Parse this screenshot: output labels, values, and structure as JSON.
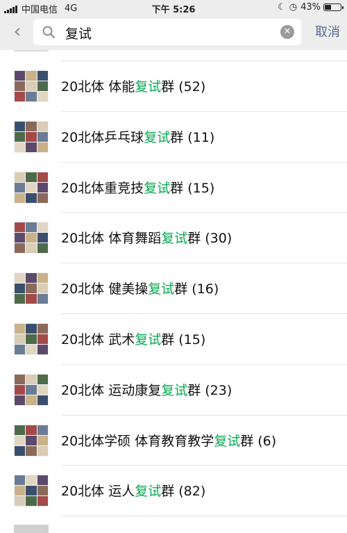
{
  "status_bar": {
    "carrier": "中国电信",
    "network": "4G",
    "time": "下午 5:26",
    "battery": "43%",
    "battery_level": 0.43
  },
  "search": {
    "query": "复试",
    "cancel_label": "取消"
  },
  "results": [
    {
      "prefix": "20北体 体能",
      "highlight": "复试",
      "suffix": "群 (52)"
    },
    {
      "prefix": "20北体乒乓球",
      "highlight": "复试",
      "suffix": "群 (11)"
    },
    {
      "prefix": "20北体重竞技",
      "highlight": "复试",
      "suffix": "群 (15)"
    },
    {
      "prefix": "20北体 体育舞蹈",
      "highlight": "复试",
      "suffix": "群 (30)"
    },
    {
      "prefix": "20北体 健美操",
      "highlight": "复试",
      "suffix": "群 (16)"
    },
    {
      "prefix": "20北体 武术",
      "highlight": "复试",
      "suffix": "群 (15)"
    },
    {
      "prefix": "20北体 运动康复",
      "highlight": "复试",
      "suffix": "群 (23)"
    },
    {
      "prefix": "20北体学硕 体育教育教学",
      "highlight": "复试",
      "suffix": "群 (6)"
    },
    {
      "prefix": "20北体 运人",
      "highlight": "复试",
      "suffix": "群 (82)"
    }
  ],
  "colors": {
    "highlight": "#07a84f",
    "link": "#576b95",
    "avatar_tiles": [
      "#5b4a6b",
      "#c9b28a",
      "#3a4f6e",
      "#8a6a5a",
      "#d9cdb8",
      "#4e6a4a",
      "#a34a4a",
      "#6b7d95",
      "#e0d6c4"
    ]
  }
}
